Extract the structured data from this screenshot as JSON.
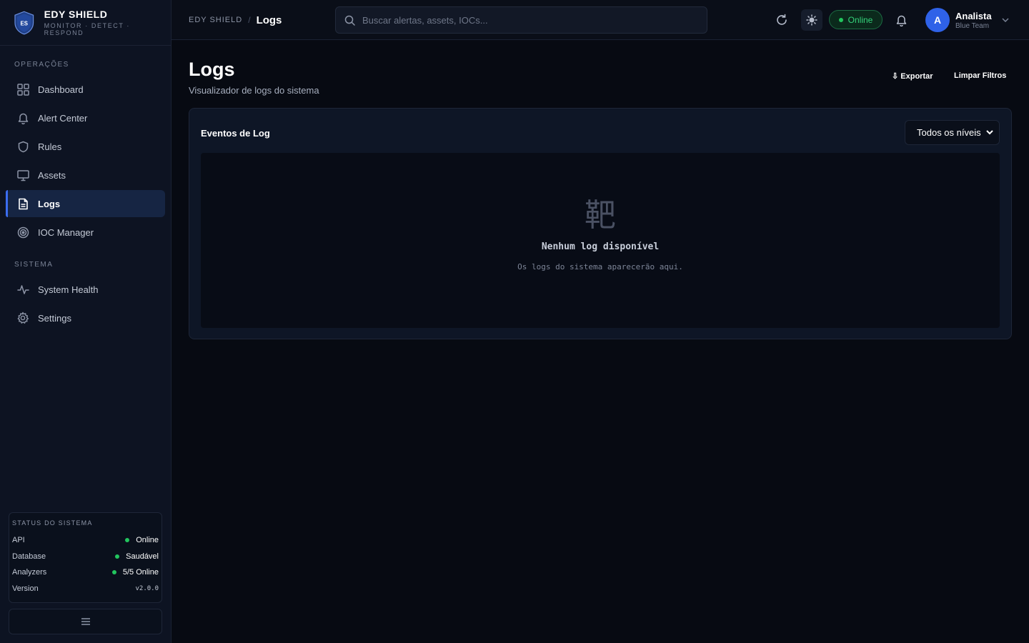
{
  "brand": {
    "name": "EDY SHIELD",
    "tagline": "MONITOR · DETECT · RESPOND",
    "logo_text": "ES"
  },
  "sidebar": {
    "operations_label": "OPERAÇÕES",
    "operations": [
      {
        "label": "Dashboard",
        "icon": "grid-icon"
      },
      {
        "label": "Alert Center",
        "icon": "bell-icon"
      },
      {
        "label": "Rules",
        "icon": "shield-icon"
      },
      {
        "label": "Assets",
        "icon": "monitor-icon"
      },
      {
        "label": "Logs",
        "icon": "document-icon",
        "active": true
      },
      {
        "label": "IOC Manager",
        "icon": "target-icon"
      }
    ],
    "system_label": "SISTEMA",
    "system": [
      {
        "label": "System Health",
        "icon": "activity-icon"
      },
      {
        "label": "Settings",
        "icon": "gear-icon"
      }
    ]
  },
  "system_status": {
    "title": "STATUS DO SISTEMA",
    "rows": [
      {
        "label": "API",
        "value": "Online"
      },
      {
        "label": "Database",
        "value": "Saudável"
      },
      {
        "label": "Analyzers",
        "value": "5/5 Online"
      },
      {
        "label": "Version",
        "value": "v2.0.0"
      }
    ]
  },
  "topbar": {
    "breadcrumb_root": "EDY SHIELD",
    "breadcrumb_sep": "/",
    "breadcrumb_current": "Logs",
    "search_placeholder": "Buscar alertas, assets, IOCs...",
    "status_label": "Online",
    "user_name": "Analista",
    "user_role": "Blue Team",
    "user_initial": "A"
  },
  "page": {
    "title": "Logs",
    "subtitle": "Visualizador de logs do sistema",
    "export_label": "⇩ Exportar",
    "clear_label": "Limpar Filtros"
  },
  "card": {
    "title": "Eventos de Log",
    "level_select": "Todos os níveis",
    "empty_icon": "靶",
    "empty_title": "Nenhum log disponível",
    "empty_subtitle": "Os logs do sistema aparecerão aqui."
  },
  "colors": {
    "accent": "#3b6df0",
    "online": "#22c55e",
    "background": "#070a12",
    "sidebar": "#0d1322"
  }
}
